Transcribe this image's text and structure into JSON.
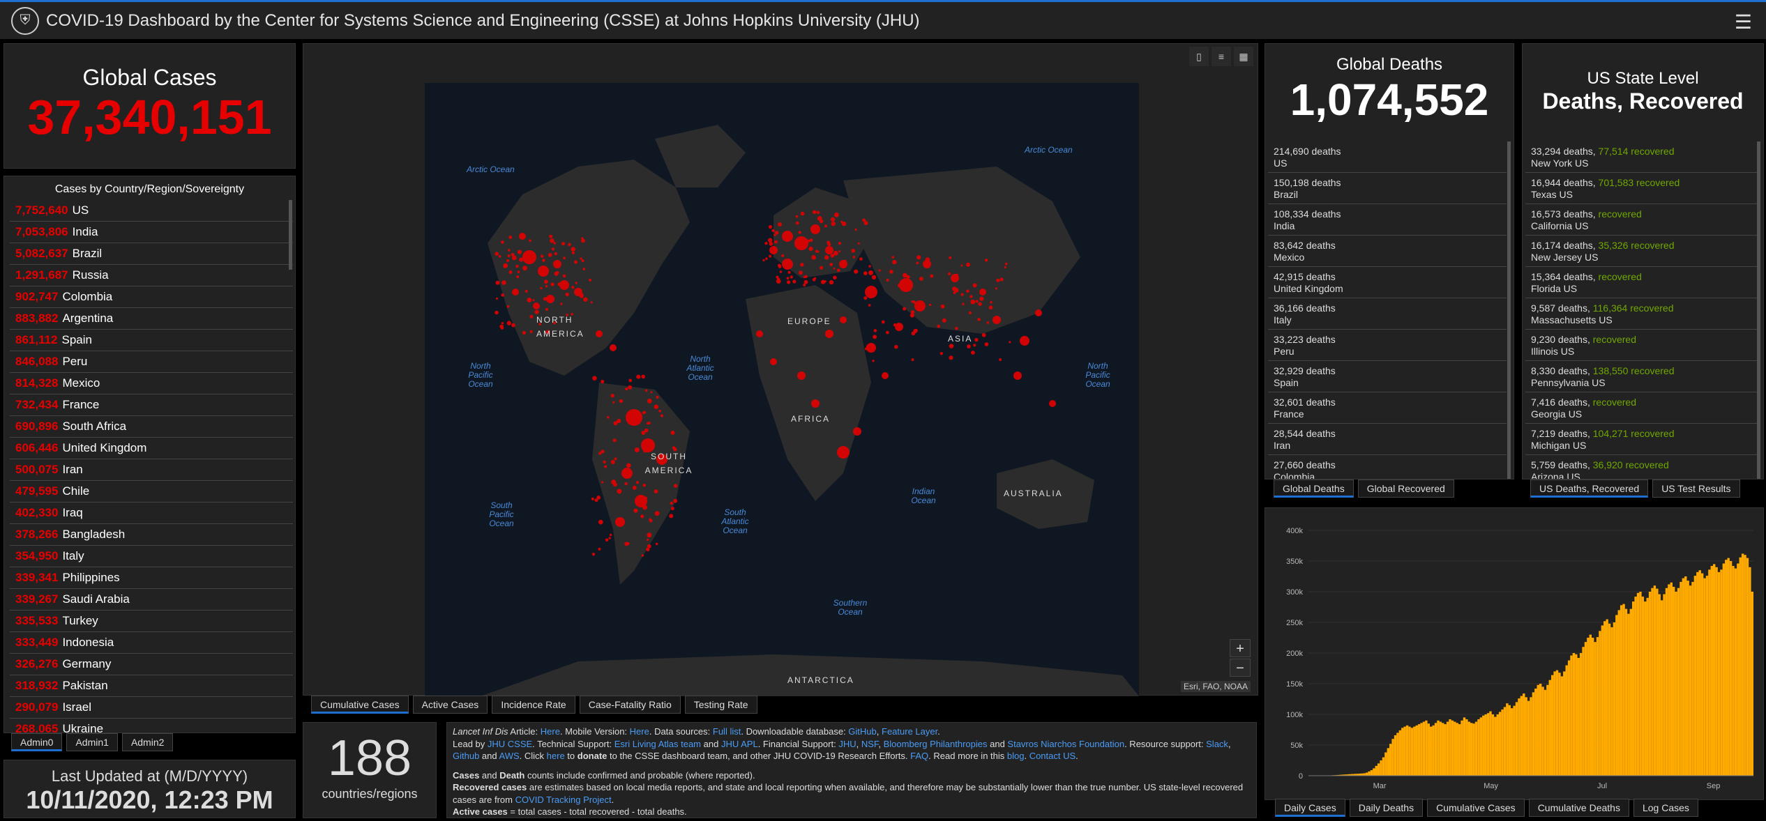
{
  "header": {
    "title": "COVID-19 Dashboard by the Center for Systems Science and Engineering (CSSE) at Johns Hopkins University (JHU)",
    "menu_icon": "hamburger-icon"
  },
  "global_cases": {
    "label": "Global Cases",
    "value": "37,340,151"
  },
  "country_list": {
    "title": "Cases by Country/Region/Sovereignty",
    "rows": [
      {
        "n": "7,752,640",
        "c": "US"
      },
      {
        "n": "7,053,806",
        "c": "India"
      },
      {
        "n": "5,082,637",
        "c": "Brazil"
      },
      {
        "n": "1,291,687",
        "c": "Russia"
      },
      {
        "n": "902,747",
        "c": "Colombia"
      },
      {
        "n": "883,882",
        "c": "Argentina"
      },
      {
        "n": "861,112",
        "c": "Spain"
      },
      {
        "n": "846,088",
        "c": "Peru"
      },
      {
        "n": "814,328",
        "c": "Mexico"
      },
      {
        "n": "732,434",
        "c": "France"
      },
      {
        "n": "690,896",
        "c": "South Africa"
      },
      {
        "n": "606,446",
        "c": "United Kingdom"
      },
      {
        "n": "500,075",
        "c": "Iran"
      },
      {
        "n": "479,595",
        "c": "Chile"
      },
      {
        "n": "402,330",
        "c": "Iraq"
      },
      {
        "n": "378,266",
        "c": "Bangladesh"
      },
      {
        "n": "354,950",
        "c": "Italy"
      },
      {
        "n": "339,341",
        "c": "Philippines"
      },
      {
        "n": "339,267",
        "c": "Saudi Arabia"
      },
      {
        "n": "335,533",
        "c": "Turkey"
      },
      {
        "n": "333,449",
        "c": "Indonesia"
      },
      {
        "n": "326,276",
        "c": "Germany"
      },
      {
        "n": "318,932",
        "c": "Pakistan"
      },
      {
        "n": "290,079",
        "c": "Israel"
      },
      {
        "n": "268,065",
        "c": "Ukraine"
      }
    ],
    "tabs": [
      "Admin0",
      "Admin1",
      "Admin2"
    ]
  },
  "last_updated": {
    "label": "Last Updated at (M/D/YYYY)",
    "value": "10/11/2020, 12:23 PM"
  },
  "map": {
    "tabs": [
      "Cumulative Cases",
      "Active Cases",
      "Incidence Rate",
      "Case-Fatality Ratio",
      "Testing Rate"
    ],
    "attribution": "Esri, FAO, NOAA",
    "zoom_in": "+",
    "zoom_out": "−",
    "oceans": [
      "Arctic Ocean",
      "Arctic Ocean",
      "North Pacific Ocean",
      "North Atlantic Ocean",
      "North Pacific Ocean",
      "South Pacific Ocean",
      "South Atlantic Ocean",
      "Indian Ocean",
      "Southern Ocean"
    ],
    "continents": [
      "NORTH AMERICA",
      "EUROPE",
      "ASIA",
      "AFRICA",
      "SOUTH AMERICA",
      "AUSTRALIA",
      "ANTARCTICA"
    ]
  },
  "country_count": {
    "value": "188",
    "label": "countries/regions"
  },
  "info": {
    "p1_a": "Lancet Inf Dis",
    "p1_b": " Article: ",
    "here1": "Here",
    "p1_c": ". Mobile Version: ",
    "here2": "Here",
    "p1_d": ". Data sources: ",
    "fulllist": "Full list",
    "p1_e": ". Downloadable database: ",
    "github": "GitHub",
    "sep": ", ",
    "feature": "Feature Layer",
    "p1_f": ".",
    "p2_a": "Lead by ",
    "jhucsse": "JHU CSSE",
    "p2_b": ". Technical Support: ",
    "esri": "Esri Living Atlas team",
    "and": " and ",
    "jhuapl": "JHU APL",
    "p2_c": ". Financial Support: ",
    "jhu": "JHU",
    "nsf": "NSF",
    "bloomberg": "Bloomberg Philanthropies",
    "stavros": "Stavros Niarchos Foundation",
    "p2_d": ". Resource support: ",
    "slack": "Slack",
    "github2": "Github",
    "aws": "AWS",
    "p2_e": ". Click ",
    "here3": "here",
    "p2_f": " to ",
    "donate": "donate",
    "p2_g": " to the CSSE dashboard team, and other JHU COVID-19 Research Efforts. ",
    "faq": "FAQ",
    "p2_h": ". Read more in this ",
    "blog": "blog",
    "p2_i": ". ",
    "contact": "Contact US",
    "p3_a": "Cases",
    "p3_b": " and ",
    "p3_c": "Death",
    "p3_d": " counts include confirmed and probable (where reported).",
    "p4_a": "Recovered cases",
    "p4_b": " are estimates based on local media reports, and state and local reporting when available, and therefore may be substantially lower than the true number. US state-level recovered cases are from ",
    "covidtrack": "COVID Tracking Project",
    "p4_c": ".",
    "p5_a": "Active cases",
    "p5_b": " = total cases - total recovered - total deaths."
  },
  "global_deaths": {
    "label": "Global Deaths",
    "value": "1,074,552",
    "rows": [
      {
        "n": "214,690 deaths",
        "c": "US"
      },
      {
        "n": "150,198 deaths",
        "c": "Brazil"
      },
      {
        "n": "108,334 deaths",
        "c": "India"
      },
      {
        "n": "83,642 deaths",
        "c": "Mexico"
      },
      {
        "n": "42,915 deaths",
        "c": "United Kingdom"
      },
      {
        "n": "36,166 deaths",
        "c": "Italy"
      },
      {
        "n": "33,223 deaths",
        "c": "Peru"
      },
      {
        "n": "32,929 deaths",
        "c": "Spain"
      },
      {
        "n": "32,601 deaths",
        "c": "France"
      },
      {
        "n": "28,544 deaths",
        "c": "Iran"
      },
      {
        "n": "27,660 deaths",
        "c": "Colombia"
      }
    ],
    "tabs": [
      "Global Deaths",
      "Global Recovered"
    ]
  },
  "us_state": {
    "label1": "US State Level",
    "label2": "Deaths, Recovered",
    "rows": [
      {
        "d": "33,294 deaths,",
        "r": "77,514",
        "s": "New York US"
      },
      {
        "d": "16,944 deaths,",
        "r": "701,583",
        "s": "Texas US"
      },
      {
        "d": "16,573 deaths,",
        "r": "",
        "s": "California US"
      },
      {
        "d": "16,174 deaths,",
        "r": "35,326",
        "s": "New Jersey US"
      },
      {
        "d": "15,364 deaths,",
        "r": "",
        "s": "Florida US"
      },
      {
        "d": "9,587 deaths,",
        "r": "116,364",
        "s": "Massachusetts US"
      },
      {
        "d": "9,230 deaths,",
        "r": "",
        "s": "Illinois US"
      },
      {
        "d": "8,330 deaths,",
        "r": "138,550",
        "s": "Pennsylvania US"
      },
      {
        "d": "7,416 deaths,",
        "r": "",
        "s": "Georgia US"
      },
      {
        "d": "7,219 deaths,",
        "r": "104,271",
        "s": "Michigan US"
      },
      {
        "d": "5,759 deaths,",
        "r": "36,920",
        "s": "Arizona US"
      }
    ],
    "recovered_word": "recovered",
    "tabs": [
      "US Deaths, Recovered",
      "US Test Results"
    ]
  },
  "chart_data": {
    "type": "bar",
    "title": "",
    "xlabel": "",
    "ylabel": "",
    "y_ticks": [
      "0",
      "50k",
      "100k",
      "150k",
      "200k",
      "250k",
      "300k",
      "350k",
      "400k"
    ],
    "x_ticks": [
      "Mar",
      "May",
      "Jul",
      "Sep"
    ],
    "ylim": [
      0,
      400000
    ],
    "color": "#ffaa00",
    "values": [
      0,
      0,
      0,
      0,
      100,
      200,
      300,
      400,
      500,
      600,
      800,
      1000,
      1200,
      1500,
      1800,
      2000,
      2200,
      2500,
      2800,
      3000,
      3200,
      3400,
      3600,
      4000,
      5000,
      7000,
      9000,
      12000,
      16000,
      20000,
      25000,
      30000,
      38000,
      45000,
      52000,
      60000,
      66000,
      70000,
      74000,
      78000,
      80000,
      82000,
      80000,
      78000,
      80000,
      82000,
      84000,
      86000,
      88000,
      90000,
      85000,
      80000,
      82000,
      86000,
      90000,
      88000,
      86000,
      84000,
      88000,
      92000,
      90000,
      88000,
      86000,
      84000,
      90000,
      95000,
      92000,
      88000,
      86000,
      85000,
      88000,
      92000,
      95000,
      98000,
      100000,
      102000,
      105000,
      100000,
      96000,
      100000,
      104000,
      108000,
      112000,
      118000,
      115000,
      110000,
      114000,
      120000,
      126000,
      130000,
      134000,
      128000,
      122000,
      128000,
      136000,
      142000,
      148000,
      150000,
      145000,
      140000,
      148000,
      156000,
      164000,
      170000,
      172000,
      168000,
      162000,
      170000,
      180000,
      188000,
      196000,
      200000,
      198000,
      192000,
      200000,
      210000,
      218000,
      225000,
      230000,
      225000,
      218000,
      226000,
      236000,
      245000,
      252000,
      255000,
      248000,
      242000,
      250000,
      262000,
      270000,
      278000,
      280000,
      272000,
      264000,
      272000,
      284000,
      292000,
      298000,
      300000,
      292000,
      284000,
      290000,
      300000,
      306000,
      310000,
      305000,
      296000,
      286000,
      296000,
      306000,
      312000,
      315000,
      308000,
      300000,
      306000,
      316000,
      322000,
      325000,
      318000,
      310000,
      316000,
      326000,
      332000,
      335000,
      330000,
      322000,
      326000,
      336000,
      342000,
      345000,
      340000,
      332000,
      336000,
      346000,
      352000,
      355000,
      350000,
      342000,
      338000,
      346000,
      356000,
      362000,
      360000,
      355000,
      340000,
      300000
    ]
  },
  "chart_tabs": [
    "Daily Cases",
    "Daily Deaths",
    "Cumulative Cases",
    "Cumulative Deaths",
    "Log Cases"
  ]
}
